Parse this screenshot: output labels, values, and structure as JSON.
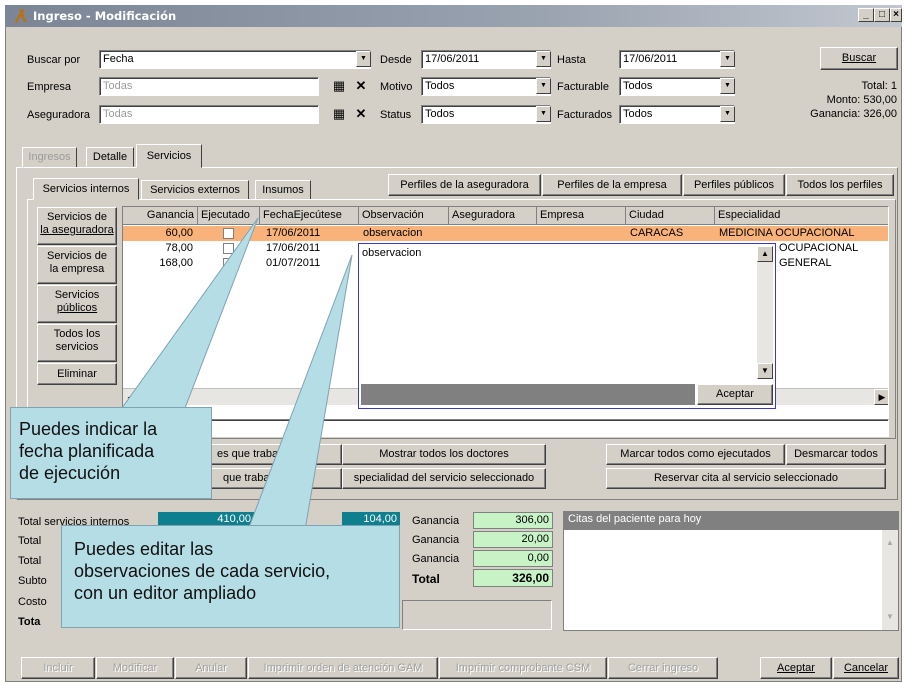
{
  "window": {
    "title": "Ingreso - Modificación",
    "controls": [
      "_",
      "□",
      "×"
    ]
  },
  "filters": {
    "buscar_por_label": "Buscar por",
    "buscar_por_value": "Fecha",
    "empresa_label": "Empresa",
    "empresa_value": "Todas",
    "aseguradora_label": "Aseguradora",
    "aseguradora_value": "Todas",
    "desde_label": "Desde",
    "desde_value": "17/06/2011",
    "motivo_label": "Motivo",
    "motivo_value": "Todos",
    "status_label": "Status",
    "status_value": "Todos",
    "hasta_label": "Hasta",
    "hasta_value": "17/06/2011",
    "facturable_label": "Facturable",
    "facturable_value": "Todos",
    "facturados_label": "Facturados",
    "facturados_value": "Todos",
    "buscar_button": "Buscar",
    "total": "Total: 1",
    "monto": "Monto: 530,00",
    "ganancia": "Ganancia: 326,00"
  },
  "main_tabs": [
    "Ingresos",
    "Detalle",
    "Servicios"
  ],
  "sub_tabs": [
    "Servicios internos",
    "Servicios externos",
    "Insumos"
  ],
  "perfil_buttons": [
    "Perfiles de la aseguradora",
    "Perfiles de la empresa",
    "Perfiles públicos",
    "Todos los perfiles"
  ],
  "side_buttons": [
    "Servicios de la aseguradora",
    "Servicios de la empresa",
    "Servicios públicos",
    "Todos los servicios",
    "Eliminar"
  ],
  "side_short": [
    "Servicios de",
    "la aseguradora",
    "Servicios de",
    "la empresa",
    "Servicios",
    "públicos",
    "Todos los",
    "servicios",
    "Eliminar"
  ],
  "grid": {
    "headers": [
      "Ganancia",
      "Ejecutado",
      "FechaEjecútese",
      "Observación",
      "Aseguradora",
      "Empresa",
      "Ciudad",
      "Especialidad"
    ],
    "rows": [
      {
        "ganancia": "60,00",
        "fecha": "17/06/2011",
        "observacion": "observacion",
        "ciudad": "CARACAS",
        "especialidad": "MEDICINA OCUPACIONAL"
      },
      {
        "ganancia": "78,00",
        "fecha": "17/06/2011",
        "especialidad": "OCUPACIONAL"
      },
      {
        "ganancia": "168,00",
        "fecha": "01/07/2011",
        "especialidad": "GENERAL"
      }
    ]
  },
  "editor": {
    "text": "observacion",
    "accept_button": "Aceptar"
  },
  "action_buttons": {
    "doctores_que_trabajan": "es que trabaj",
    "doctores_que_trabajan2": "que trabaj",
    "mostrar_todos": "Mostrar todos los doctores",
    "especialidad": "specialidad del servicio seleccionado",
    "marcar_todos": "Marcar todos como ejecutados",
    "desmarcar_todos": "Desmarcar todos",
    "reservar_cita": "Reservar cita al servicio seleccionado"
  },
  "totals": {
    "labels": [
      "Total servicios internos",
      "Total",
      "Total",
      "Subto",
      "Costo",
      "Tota"
    ],
    "teal_value_1": "410,00",
    "teal_value_2": "104,00",
    "ganancia_label": "Ganancia",
    "ganancias": [
      "306,00",
      "20,00",
      "0,00"
    ],
    "total_label": "Total",
    "total_value": "326,00"
  },
  "citas": {
    "title": "Citas del paciente para hoy"
  },
  "bottom_buttons": {
    "incluir": "Incluir",
    "modificar": "Modificar",
    "anular": "Anular",
    "imprimir_orden": "Imprimir orden de atención GAM",
    "imprimir_comprobante": "Imprimir comprobante CSM",
    "cerrar_ingreso": "Cerrar ingreso",
    "aceptar": "Aceptar",
    "cancelar": "Cancelar"
  },
  "callouts": {
    "fecha": [
      "Puedes indicar la",
      "fecha planificada",
      "de ejecución"
    ],
    "obs": [
      "Puedes editar las",
      "observaciones de cada servicio,",
      "con un editor ampliado"
    ]
  },
  "colors": {
    "selected_row": "#f9b27a",
    "teal": "#0e7f8e",
    "green": "#c7f3c7",
    "callout": "#b5dde6"
  }
}
